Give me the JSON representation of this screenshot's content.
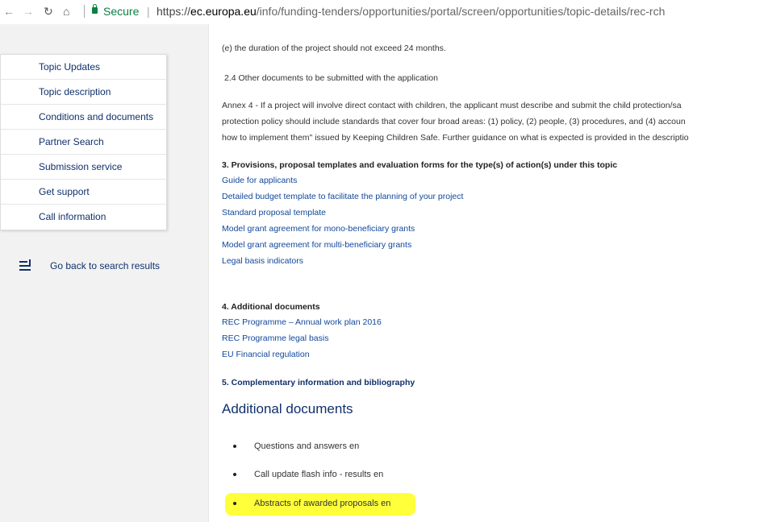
{
  "browser": {
    "secure_label": "Secure",
    "url_scheme": "https://",
    "url_host": "ec.europa.eu",
    "url_path": "/info/funding-tenders/opportunities/portal/screen/opportunities/topic-details/rec-rch"
  },
  "sidebar": {
    "items": [
      {
        "label": "Topic Updates"
      },
      {
        "label": "Topic description"
      },
      {
        "label": "Conditions and documents"
      },
      {
        "label": "Partner Search"
      },
      {
        "label": "Submission service"
      },
      {
        "label": "Get support"
      },
      {
        "label": "Call information"
      }
    ],
    "back_label": "Go back to search results"
  },
  "content": {
    "line_e": "(e) the duration of the project should not exceed 24 months.",
    "line_24": "2.4 Other documents to be submitted with the application",
    "annex_1": "Annex 4 - If a project will involve direct contact with children, the applicant must describe and submit the child protection/sa",
    "annex_2": "protection policy should include standards that cover four broad areas: (1) policy, (2) people, (3) procedures, and (4) accoun",
    "annex_3": "how to implement them\" issued by Keeping Children Safe. Further guidance on what is expected is provided in the descriptio",
    "section3_heading": "3. Provisions, proposal templates and evaluation forms for the type(s) of action(s) under this topic",
    "section3_links": [
      "Guide for applicants",
      "Detailed budget template to facilitate the planning of your project",
      "Standard proposal template",
      "Model grant agreement for mono-beneficiary grants",
      "Model grant agreement for multi-beneficiary grants",
      "Legal basis indicators"
    ],
    "section4_heading": "4. Additional documents",
    "section4_links": [
      "REC Programme – Annual work plan 2016",
      "REC Programme legal basis",
      "EU Financial regulation"
    ],
    "section5_heading": "5. Complementary information and bibliography",
    "additional_title": "Additional documents",
    "additional_items": [
      "Questions and answers en",
      "Call update flash info - results en",
      "Abstracts of awarded proposals en"
    ],
    "highlight_color": "#ffff3a"
  }
}
